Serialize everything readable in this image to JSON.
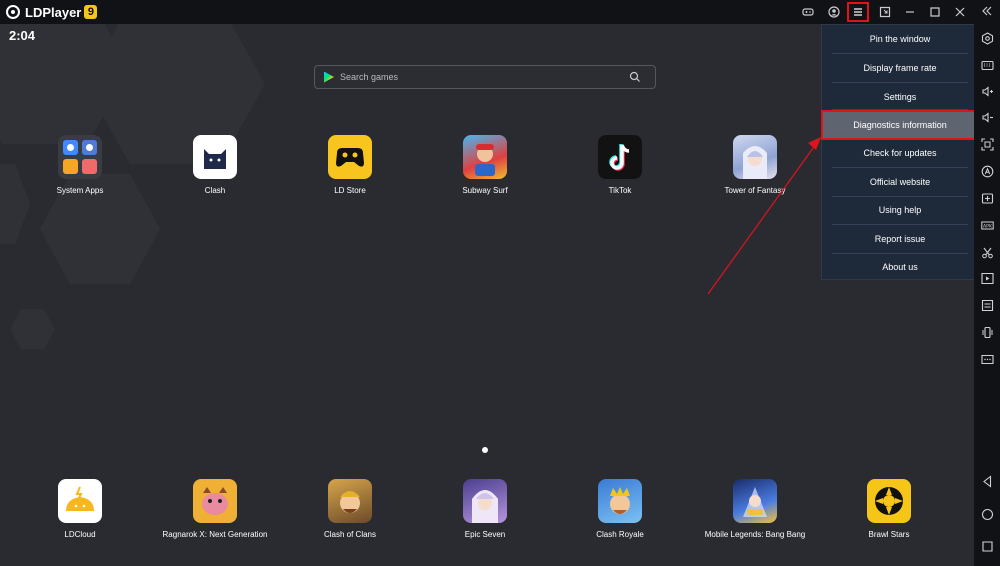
{
  "window": {
    "app_name": "LDPlayer",
    "version_badge": "9"
  },
  "status": {
    "clock": "2:04"
  },
  "search": {
    "placeholder": "Search games"
  },
  "home_apps": [
    {
      "label": "System Apps",
      "icon": "system-apps-folder-icon"
    },
    {
      "label": "Clash",
      "icon": "clash-cat-icon"
    },
    {
      "label": "LD Store",
      "icon": "ld-store-gamepad-icon"
    },
    {
      "label": "Subway Surf",
      "icon": "subway-surf-icon"
    },
    {
      "label": "TikTok",
      "icon": "tiktok-icon"
    },
    {
      "label": "Tower of Fantasy",
      "icon": "tower-of-fantasy-icon"
    }
  ],
  "dock_apps": [
    {
      "label": "LDCloud",
      "icon": "ldcloud-icon"
    },
    {
      "label": "Ragnarok X: Next Generation",
      "icon": "ragnarok-x-icon"
    },
    {
      "label": "Clash of Clans",
      "icon": "clash-of-clans-icon"
    },
    {
      "label": "Epic Seven",
      "icon": "epic-seven-icon"
    },
    {
      "label": "Clash Royale",
      "icon": "clash-royale-icon"
    },
    {
      "label": "Mobile Legends: Bang Bang",
      "icon": "mobile-legends-icon"
    },
    {
      "label": "Brawl Stars",
      "icon": "brawl-stars-icon"
    }
  ],
  "menu": {
    "items": [
      "Pin the window",
      "Display frame rate",
      "Settings",
      "Diagnostics information",
      "Check for updates",
      "Official website",
      "Using help",
      "Report issue",
      "About us"
    ],
    "highlighted": "Diagnostics information"
  },
  "toolbar_icons": [
    "gamepad-icon",
    "account-icon",
    "menu-icon",
    "shrink-icon",
    "minimize-icon",
    "maximize-icon",
    "close-icon"
  ],
  "sidebar_icons": [
    "settings-icon",
    "keyboard-icon",
    "volume-up-icon",
    "volume-down-icon",
    "screenshot-icon",
    "operation-record-icon",
    "add-app-icon",
    "apk-install-icon",
    "scissors-icon",
    "video-icon",
    "sync-icon",
    "shake-icon",
    "more-icon",
    "back-icon",
    "home-icon",
    "recents-icon"
  ],
  "colors": {
    "highlight_red": "#e0131b",
    "menu_bg": "#1e2a3a",
    "screen_bg": "#2a2b30",
    "version_badge": "#f5c518"
  }
}
